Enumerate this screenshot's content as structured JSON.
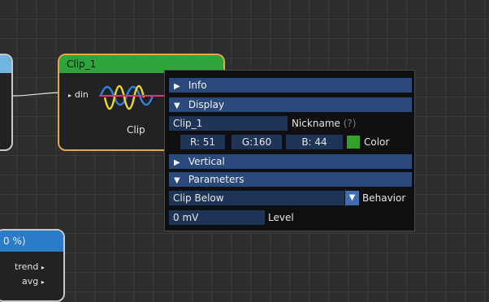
{
  "colors": {
    "clip_color": "#33a02c",
    "accent": "#294a7a"
  },
  "clip_node": {
    "title": "Clip_1",
    "input_port": "din",
    "label": "Clip"
  },
  "bottom_node": {
    "title": "0 %)",
    "outputs": [
      "trend",
      "avg"
    ]
  },
  "popup": {
    "sections": {
      "info": "Info",
      "display": "Display",
      "vertical": "Vertical",
      "parameters": "Parameters"
    },
    "display": {
      "nickname_value": "Clip_1",
      "nickname_label": "Nickname",
      "help": "(?)",
      "r": "R: 51",
      "g": "G:160",
      "b": "B: 44",
      "color_label": "Color"
    },
    "parameters": {
      "behavior_value": "Clip Below",
      "behavior_label": "Behavior",
      "level_value": "0 mV",
      "level_label": "Level"
    }
  },
  "icons": {
    "collapsed": "▶",
    "expanded": "▼"
  }
}
